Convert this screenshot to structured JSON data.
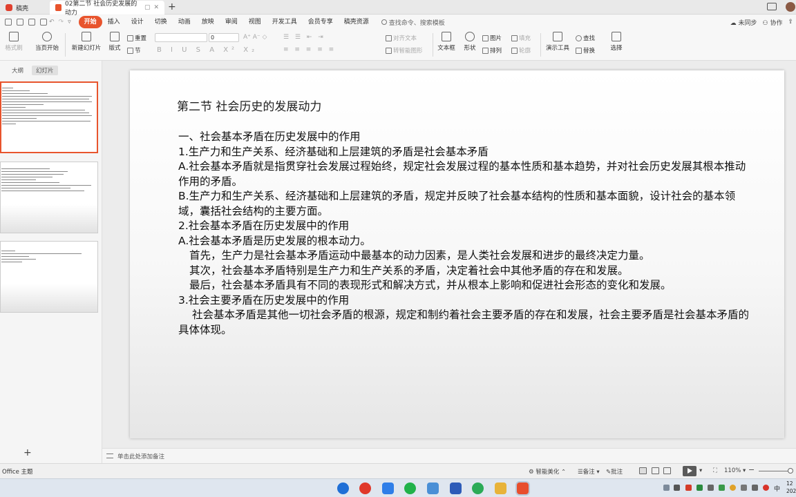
{
  "titlebar": {
    "home_tab": "稿壳",
    "doc_tab": "02第二节 社会历史发展的动力"
  },
  "menu": {
    "items": [
      "开始",
      "插入",
      "设计",
      "切换",
      "动画",
      "放映",
      "审阅",
      "视图",
      "开发工具",
      "会员专享",
      "稿壳资源"
    ],
    "search": "查找命令、搜索模板",
    "sync": "未同步",
    "collab": "协作"
  },
  "ribbon": {
    "format_painter": "格式刷",
    "from_start": "当页开始",
    "new_slide": "新建幻灯片",
    "layout": "版式",
    "section": "节",
    "reset": "重置",
    "font_size": "0",
    "text_direction": "对齐文本",
    "smartart": "转智能图形",
    "textbox": "文本框",
    "shape": "形状",
    "picture": "图片",
    "arrange": "排列",
    "fill": "填充",
    "outline": "轮廓",
    "present_tools": "演示工具",
    "find": "查找",
    "replace": "替换",
    "select": "选择"
  },
  "panel": {
    "tab_outline": "大纲",
    "tab_slides": "幻灯片"
  },
  "slide": {
    "title": "第二节 社会历史的发展动力",
    "lines": [
      "一、社会基本矛盾在历史发展中的作用",
      "1.生产力和生产关系、经济基础和上层建筑的矛盾是社会基本矛盾",
      "A.社会基本矛盾就是指贯穿社会发展过程始终，规定社会发展过程的基本性质和基本趋势，并对社会历史发展其根本推动作用的矛盾。",
      "B.生产力和生产关系、经济基础和上层建筑的矛盾，规定并反映了社会基本结构的性质和基本面貌，设计社会的基本领域，囊括社会结构的主要方面。",
      "2.社会基本矛盾在历史发展中的作用",
      "A.社会基本矛盾是历史发展的根本动力。",
      "首先，生产力是社会基本矛盾运动中最基本的动力因素，是人类社会发展和进步的最终决定力量。",
      "其次，社会基本矛盾特别是生产力和生产关系的矛盾，决定着社会中其他矛盾的存在和发展。",
      "最后，社会基本矛盾具有不同的表现形式和解决方式，并从根本上影响和促进社会形态的变化和发展。",
      "3.社会主要矛盾在历史发展中的作用",
      "社会基本矛盾是其他一切社会矛盾的根源，规定和制约着社会主要矛盾的存在和发展，社会主要矛盾是社会基本矛盾的具体体现。"
    ]
  },
  "notes": {
    "placeholder": "单击此处添加备注"
  },
  "status": {
    "theme": "Office 主题",
    "smart_beautify": "智能美化",
    "notes": "备注",
    "comments": "批注",
    "zoom": "110%"
  },
  "taskbar": {
    "ime": "中",
    "clock": "12 202"
  },
  "colors": {
    "accent": "#e8542d",
    "slide_text": "#111111"
  }
}
